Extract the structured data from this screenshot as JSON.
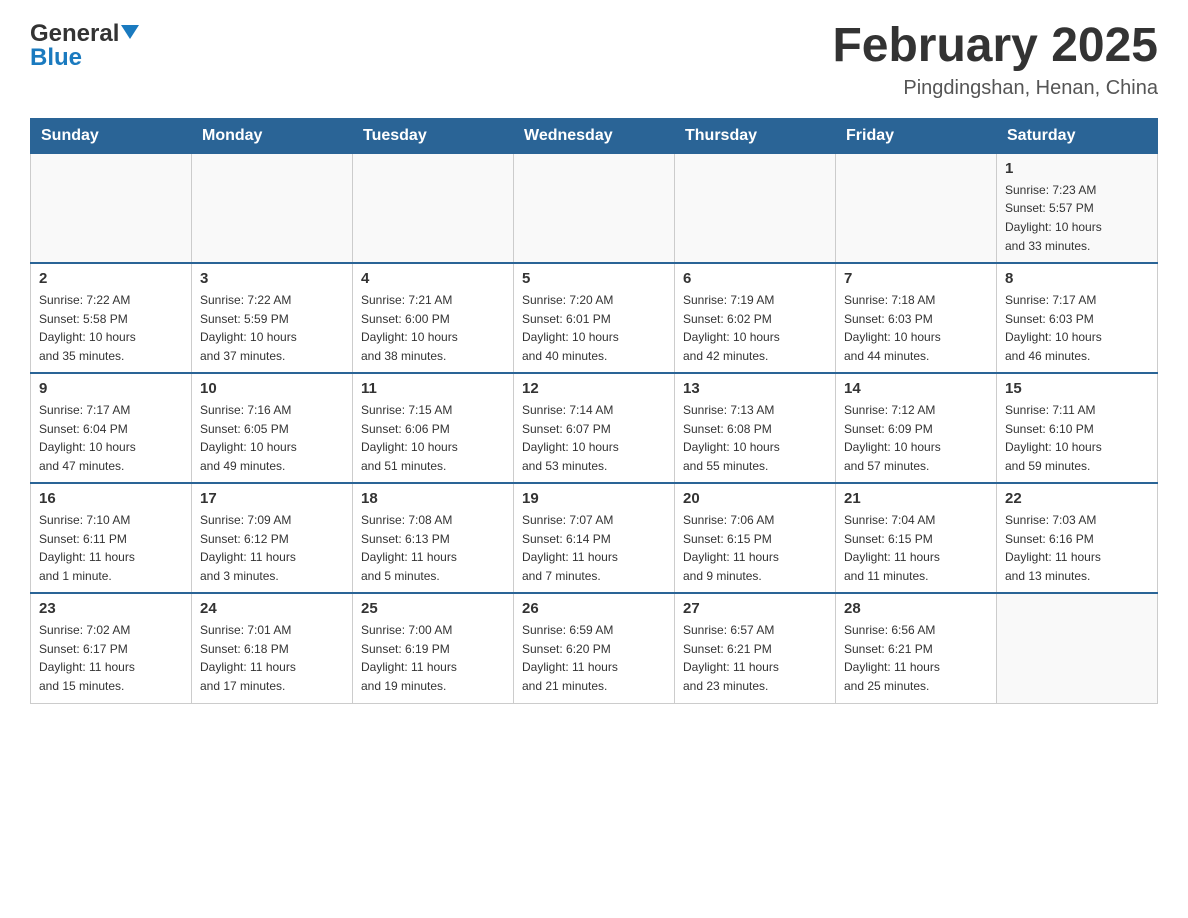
{
  "header": {
    "logo": {
      "line1": "General",
      "line2": "Blue"
    },
    "title": "February 2025",
    "location": "Pingdingshan, Henan, China"
  },
  "days_of_week": [
    "Sunday",
    "Monday",
    "Tuesday",
    "Wednesday",
    "Thursday",
    "Friday",
    "Saturday"
  ],
  "weeks": [
    {
      "cells": [
        {
          "day": "",
          "info": ""
        },
        {
          "day": "",
          "info": ""
        },
        {
          "day": "",
          "info": ""
        },
        {
          "day": "",
          "info": ""
        },
        {
          "day": "",
          "info": ""
        },
        {
          "day": "",
          "info": ""
        },
        {
          "day": "1",
          "info": "Sunrise: 7:23 AM\nSunset: 5:57 PM\nDaylight: 10 hours\nand 33 minutes."
        }
      ]
    },
    {
      "cells": [
        {
          "day": "2",
          "info": "Sunrise: 7:22 AM\nSunset: 5:58 PM\nDaylight: 10 hours\nand 35 minutes."
        },
        {
          "day": "3",
          "info": "Sunrise: 7:22 AM\nSunset: 5:59 PM\nDaylight: 10 hours\nand 37 minutes."
        },
        {
          "day": "4",
          "info": "Sunrise: 7:21 AM\nSunset: 6:00 PM\nDaylight: 10 hours\nand 38 minutes."
        },
        {
          "day": "5",
          "info": "Sunrise: 7:20 AM\nSunset: 6:01 PM\nDaylight: 10 hours\nand 40 minutes."
        },
        {
          "day": "6",
          "info": "Sunrise: 7:19 AM\nSunset: 6:02 PM\nDaylight: 10 hours\nand 42 minutes."
        },
        {
          "day": "7",
          "info": "Sunrise: 7:18 AM\nSunset: 6:03 PM\nDaylight: 10 hours\nand 44 minutes."
        },
        {
          "day": "8",
          "info": "Sunrise: 7:17 AM\nSunset: 6:03 PM\nDaylight: 10 hours\nand 46 minutes."
        }
      ]
    },
    {
      "cells": [
        {
          "day": "9",
          "info": "Sunrise: 7:17 AM\nSunset: 6:04 PM\nDaylight: 10 hours\nand 47 minutes."
        },
        {
          "day": "10",
          "info": "Sunrise: 7:16 AM\nSunset: 6:05 PM\nDaylight: 10 hours\nand 49 minutes."
        },
        {
          "day": "11",
          "info": "Sunrise: 7:15 AM\nSunset: 6:06 PM\nDaylight: 10 hours\nand 51 minutes."
        },
        {
          "day": "12",
          "info": "Sunrise: 7:14 AM\nSunset: 6:07 PM\nDaylight: 10 hours\nand 53 minutes."
        },
        {
          "day": "13",
          "info": "Sunrise: 7:13 AM\nSunset: 6:08 PM\nDaylight: 10 hours\nand 55 minutes."
        },
        {
          "day": "14",
          "info": "Sunrise: 7:12 AM\nSunset: 6:09 PM\nDaylight: 10 hours\nand 57 minutes."
        },
        {
          "day": "15",
          "info": "Sunrise: 7:11 AM\nSunset: 6:10 PM\nDaylight: 10 hours\nand 59 minutes."
        }
      ]
    },
    {
      "cells": [
        {
          "day": "16",
          "info": "Sunrise: 7:10 AM\nSunset: 6:11 PM\nDaylight: 11 hours\nand 1 minute."
        },
        {
          "day": "17",
          "info": "Sunrise: 7:09 AM\nSunset: 6:12 PM\nDaylight: 11 hours\nand 3 minutes."
        },
        {
          "day": "18",
          "info": "Sunrise: 7:08 AM\nSunset: 6:13 PM\nDaylight: 11 hours\nand 5 minutes."
        },
        {
          "day": "19",
          "info": "Sunrise: 7:07 AM\nSunset: 6:14 PM\nDaylight: 11 hours\nand 7 minutes."
        },
        {
          "day": "20",
          "info": "Sunrise: 7:06 AM\nSunset: 6:15 PM\nDaylight: 11 hours\nand 9 minutes."
        },
        {
          "day": "21",
          "info": "Sunrise: 7:04 AM\nSunset: 6:15 PM\nDaylight: 11 hours\nand 11 minutes."
        },
        {
          "day": "22",
          "info": "Sunrise: 7:03 AM\nSunset: 6:16 PM\nDaylight: 11 hours\nand 13 minutes."
        }
      ]
    },
    {
      "cells": [
        {
          "day": "23",
          "info": "Sunrise: 7:02 AM\nSunset: 6:17 PM\nDaylight: 11 hours\nand 15 minutes."
        },
        {
          "day": "24",
          "info": "Sunrise: 7:01 AM\nSunset: 6:18 PM\nDaylight: 11 hours\nand 17 minutes."
        },
        {
          "day": "25",
          "info": "Sunrise: 7:00 AM\nSunset: 6:19 PM\nDaylight: 11 hours\nand 19 minutes."
        },
        {
          "day": "26",
          "info": "Sunrise: 6:59 AM\nSunset: 6:20 PM\nDaylight: 11 hours\nand 21 minutes."
        },
        {
          "day": "27",
          "info": "Sunrise: 6:57 AM\nSunset: 6:21 PM\nDaylight: 11 hours\nand 23 minutes."
        },
        {
          "day": "28",
          "info": "Sunrise: 6:56 AM\nSunset: 6:21 PM\nDaylight: 11 hours\nand 25 minutes."
        },
        {
          "day": "",
          "info": ""
        }
      ]
    }
  ]
}
